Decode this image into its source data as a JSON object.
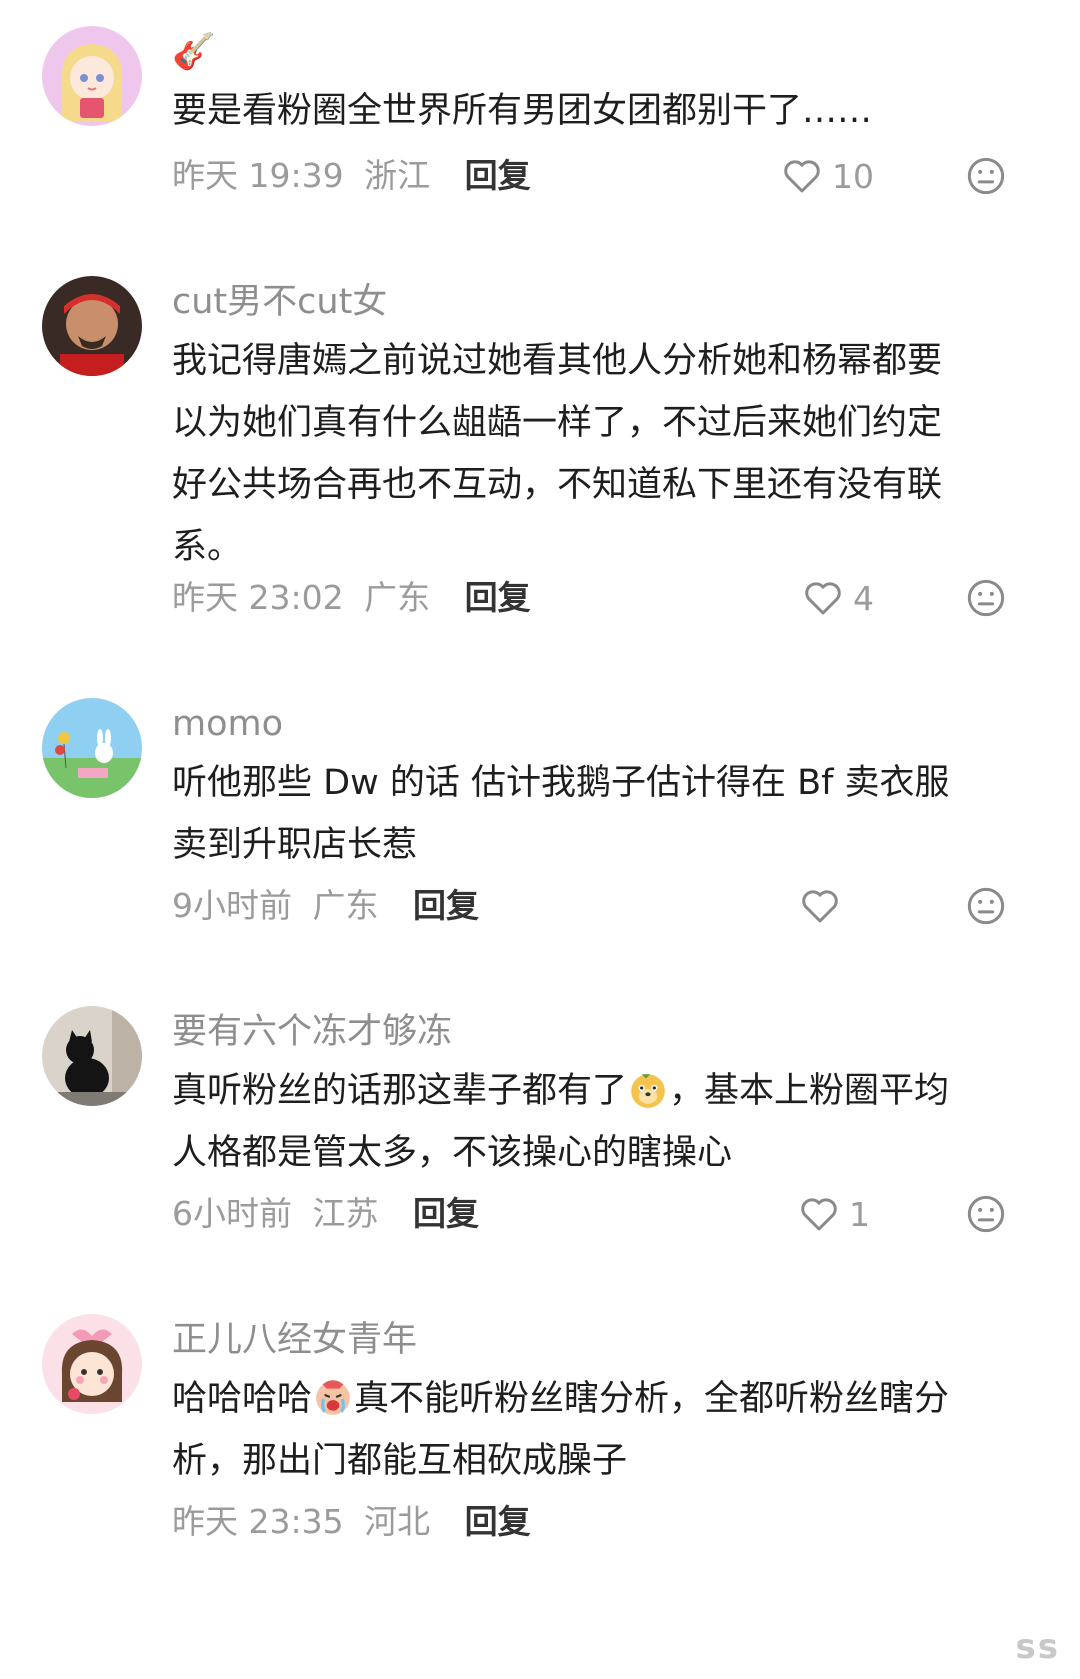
{
  "comments": [
    {
      "username": "🎸",
      "lines": [
        "要是看粉圈全世界所有男团女团都别干了……"
      ],
      "time": "昨天 19:39",
      "location": "浙江",
      "reply": "回复",
      "likes": "10"
    },
    {
      "username": "cut男不cut女",
      "lines": [
        "我记得唐嫣之前说过她看其他人分析她和杨幂都要",
        "以为她们真有什么龃龉一样了，不过后来她们约定",
        "好公共场合再也不互动，不知道私下里还有没有联",
        "系。"
      ],
      "time": "昨天 23:02",
      "location": "广东",
      "reply": "回复",
      "likes": "4"
    },
    {
      "username": "momo",
      "lines": [
        "听他那些 Dw 的话 估计我鹅子估计得在 Bf 卖衣服",
        "卖到升职店长惹"
      ],
      "time": "9小时前",
      "location": "广东",
      "reply": "回复",
      "likes": ""
    },
    {
      "username": "要有六个冻才够冻",
      "lines_a": [
        "真听粉丝的话那这辈子都有了",
        "，基本上粉圈平均"
      ],
      "lines": [
        "人格都是管太多，不该操心的瞎操心"
      ],
      "time": "6小时前",
      "location": "江苏",
      "reply": "回复",
      "likes": "1"
    },
    {
      "username": "正儿八经女青年",
      "lines_a": [
        "哈哈哈哈",
        "真不能听粉丝瞎分析，全都听粉丝瞎分"
      ],
      "lines": [
        "析，那出门都能互相砍成臊子"
      ],
      "time": "昨天 23:35",
      "location": "河北",
      "reply": "回复",
      "likes": ""
    }
  ],
  "icons": {
    "like": "heart-outline-icon",
    "dislike": "meh-face-icon"
  },
  "watermark": "ss"
}
